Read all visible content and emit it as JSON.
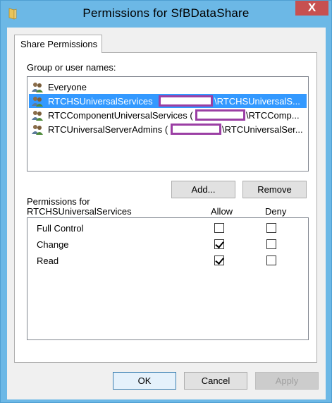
{
  "window": {
    "title": "Permissions for SfBDataShare",
    "close_glyph": "X"
  },
  "tab": {
    "label": "Share Permissions"
  },
  "groups": {
    "label": "Group or user names:",
    "items": [
      {
        "left": "Everyone",
        "right": "",
        "selected": false,
        "icon": "group-icon"
      },
      {
        "left": "RTCHSUniversalServices",
        "right": "\\RTCHSUniversalS...",
        "selected": true,
        "icon": "group-icon"
      },
      {
        "left": "RTCComponentUniversalServices (",
        "right": "\\RTCComp...",
        "selected": false,
        "icon": "group-icon"
      },
      {
        "left": "RTCUniversalServerAdmins (",
        "right": "\\RTCUniversalSer...",
        "selected": false,
        "icon": "group-icon"
      }
    ]
  },
  "buttons": {
    "add": "Add...",
    "remove": "Remove",
    "ok": "OK",
    "cancel": "Cancel",
    "apply": "Apply"
  },
  "permissions": {
    "label_line1": "Permissions for",
    "label_line2": "RTCHSUniversalServices",
    "col_allow": "Allow",
    "col_deny": "Deny",
    "rows": [
      {
        "name": "Full Control",
        "allow": false,
        "deny": false
      },
      {
        "name": "Change",
        "allow": true,
        "deny": false
      },
      {
        "name": "Read",
        "allow": true,
        "deny": false
      }
    ]
  },
  "colors": {
    "titlebar": "#6cb8e6",
    "selection": "#3399ff",
    "close": "#c75050",
    "redaction": "#9b3fa4"
  }
}
